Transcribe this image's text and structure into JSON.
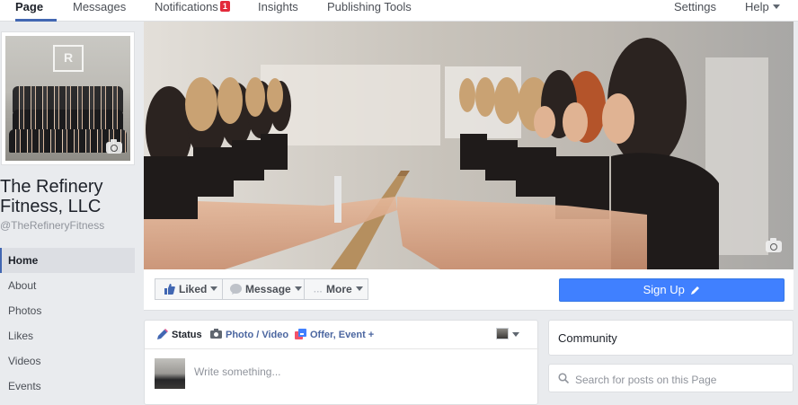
{
  "topnav": {
    "tabs": [
      {
        "label": "Page"
      },
      {
        "label": "Messages"
      },
      {
        "label": "Notifications",
        "badge": "1"
      },
      {
        "label": "Insights"
      },
      {
        "label": "Publishing Tools"
      }
    ],
    "settings": "Settings",
    "help": "Help"
  },
  "page": {
    "logo_text": "R",
    "name": "The Refinery Fitness, LLC",
    "handle": "@TheRefineryFitness"
  },
  "sidebar": {
    "items": [
      {
        "label": "Home"
      },
      {
        "label": "About"
      },
      {
        "label": "Photos"
      },
      {
        "label": "Likes"
      },
      {
        "label": "Videos"
      },
      {
        "label": "Events"
      }
    ]
  },
  "actions": {
    "liked": "Liked",
    "message": "Message",
    "more": "More",
    "signup": "Sign Up"
  },
  "composer": {
    "tabs": {
      "status": "Status",
      "photo_video": "Photo / Video",
      "offer_event": "Offer, Event +"
    },
    "placeholder": "Write something..."
  },
  "right": {
    "community": "Community",
    "search_placeholder": "Search for posts on this Page"
  },
  "colors": {
    "brand_blue": "#4267b2",
    "signup_blue": "#4080ff",
    "badge_red": "#e32a3a",
    "background": "#e9ebee"
  }
}
